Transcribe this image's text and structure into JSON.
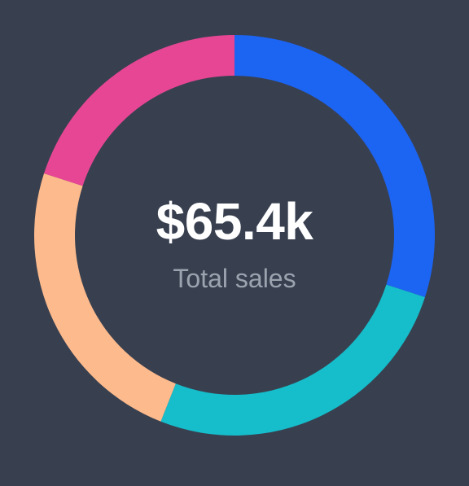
{
  "chart_data": {
    "type": "pie",
    "variant": "donut",
    "center_value": "$65.4k",
    "center_label": "Total sales",
    "slices": [
      {
        "value": 30,
        "color": "#1c64f2"
      },
      {
        "value": 26,
        "color": "#16bdca"
      },
      {
        "value": 24,
        "color": "#fdba8c"
      },
      {
        "value": 20,
        "color": "#e74694"
      }
    ]
  }
}
